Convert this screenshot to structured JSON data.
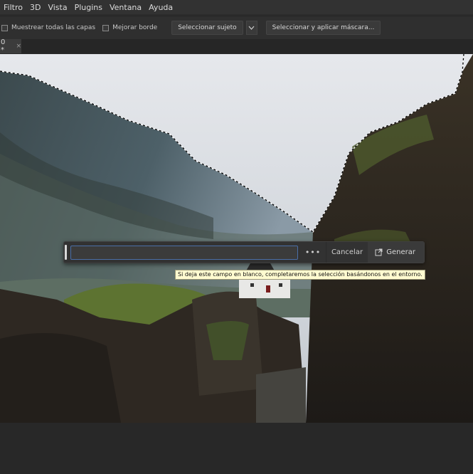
{
  "menubar": {
    "items": [
      "Filtro",
      "3D",
      "Vista",
      "Plugins",
      "Ventana",
      "Ayuda"
    ]
  },
  "options": {
    "sample_all_layers": "Muestrear todas las capas",
    "enhance_edge": "Mejorar borde",
    "select_subject": "Seleccionar sujeto",
    "select_mask": "Seleccionar y aplicar máscara..."
  },
  "tab": {
    "label": "0 *",
    "close": "×"
  },
  "generative_fill": {
    "prompt_value": "",
    "more": "•••",
    "cancel": "Cancelar",
    "generate": "Generar",
    "tooltip": "Si deja este campo en blanco, completaremos la selección basándonos en el entorno."
  }
}
